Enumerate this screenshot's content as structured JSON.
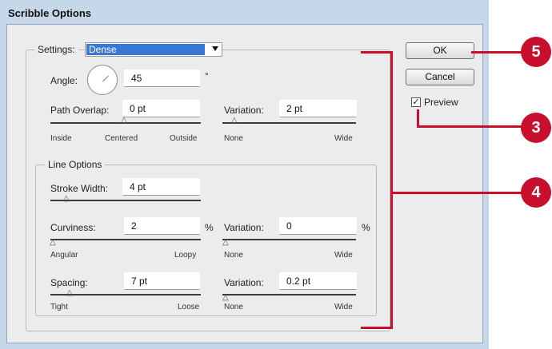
{
  "window": {
    "title": "Scribble Options"
  },
  "settings": {
    "label": "Settings:",
    "value": "Dense"
  },
  "angle": {
    "label": "Angle:",
    "value": "45",
    "unit": "°"
  },
  "path_overlap": {
    "label": "Path Overlap:",
    "value": "0 pt",
    "min_label": "Inside",
    "mid_label": "Centered",
    "max_label": "Outside"
  },
  "path_variation": {
    "label": "Variation:",
    "value": "2 pt",
    "min_label": "None",
    "max_label": "Wide"
  },
  "line_options": {
    "title": "Line Options",
    "stroke_width": {
      "label": "Stroke Width:",
      "value": "4 pt"
    },
    "curviness": {
      "label": "Curviness:",
      "value": "2",
      "unit": "%",
      "min_label": "Angular",
      "max_label": "Loopy"
    },
    "curviness_variation": {
      "label": "Variation:",
      "value": "0",
      "unit": "%",
      "min_label": "None",
      "max_label": "Wide"
    },
    "spacing": {
      "label": "Spacing:",
      "value": "7 pt",
      "min_label": "Tight",
      "max_label": "Loose"
    },
    "spacing_variation": {
      "label": "Variation:",
      "value": "0.2 pt",
      "min_label": "None",
      "max_label": "Wide"
    }
  },
  "buttons": {
    "ok": "OK",
    "cancel": "Cancel"
  },
  "preview": {
    "label": "Preview",
    "checked": true,
    "check_glyph": "✓"
  },
  "callouts": {
    "ok": "5",
    "preview": "3",
    "line_options": "4"
  },
  "colors": {
    "callout": "#c8102e",
    "selection": "#3a78d6"
  }
}
